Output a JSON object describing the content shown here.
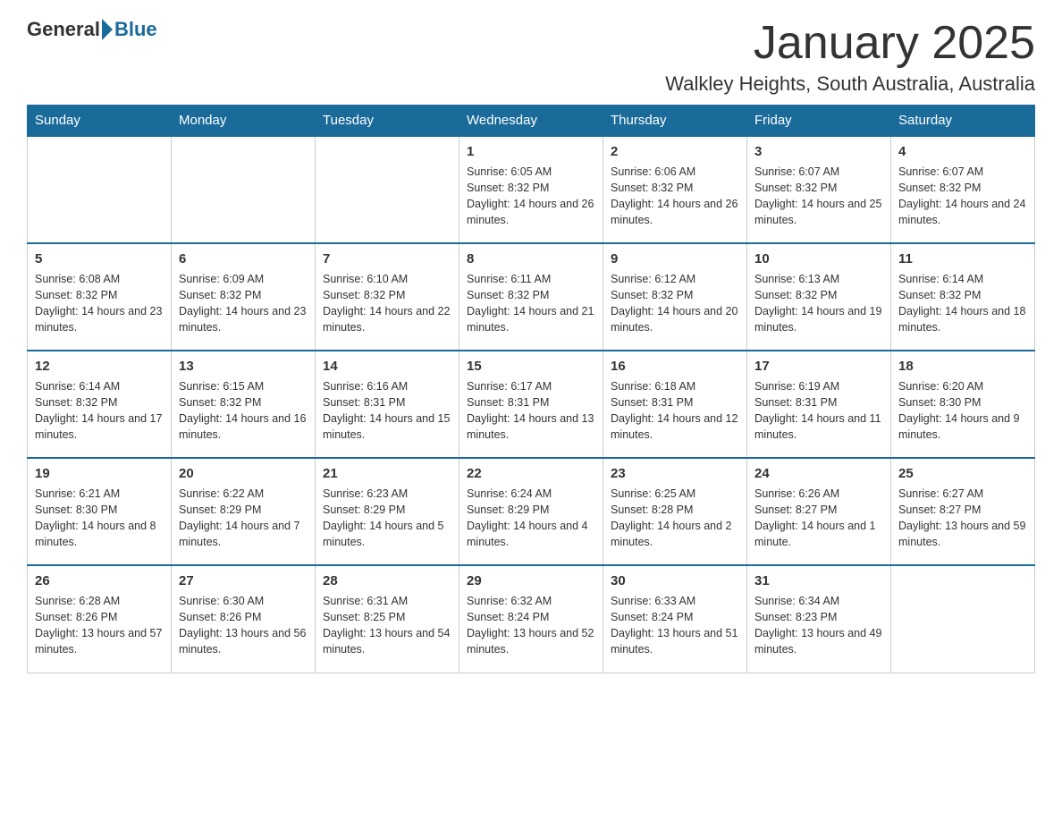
{
  "logo": {
    "general": "General",
    "blue": "Blue"
  },
  "title": "January 2025",
  "location": "Walkley Heights, South Australia, Australia",
  "weekdays": [
    "Sunday",
    "Monday",
    "Tuesday",
    "Wednesday",
    "Thursday",
    "Friday",
    "Saturday"
  ],
  "weeks": [
    [
      {
        "day": "",
        "info": ""
      },
      {
        "day": "",
        "info": ""
      },
      {
        "day": "",
        "info": ""
      },
      {
        "day": "1",
        "info": "Sunrise: 6:05 AM\nSunset: 8:32 PM\nDaylight: 14 hours and 26 minutes."
      },
      {
        "day": "2",
        "info": "Sunrise: 6:06 AM\nSunset: 8:32 PM\nDaylight: 14 hours and 26 minutes."
      },
      {
        "day": "3",
        "info": "Sunrise: 6:07 AM\nSunset: 8:32 PM\nDaylight: 14 hours and 25 minutes."
      },
      {
        "day": "4",
        "info": "Sunrise: 6:07 AM\nSunset: 8:32 PM\nDaylight: 14 hours and 24 minutes."
      }
    ],
    [
      {
        "day": "5",
        "info": "Sunrise: 6:08 AM\nSunset: 8:32 PM\nDaylight: 14 hours and 23 minutes."
      },
      {
        "day": "6",
        "info": "Sunrise: 6:09 AM\nSunset: 8:32 PM\nDaylight: 14 hours and 23 minutes."
      },
      {
        "day": "7",
        "info": "Sunrise: 6:10 AM\nSunset: 8:32 PM\nDaylight: 14 hours and 22 minutes."
      },
      {
        "day": "8",
        "info": "Sunrise: 6:11 AM\nSunset: 8:32 PM\nDaylight: 14 hours and 21 minutes."
      },
      {
        "day": "9",
        "info": "Sunrise: 6:12 AM\nSunset: 8:32 PM\nDaylight: 14 hours and 20 minutes."
      },
      {
        "day": "10",
        "info": "Sunrise: 6:13 AM\nSunset: 8:32 PM\nDaylight: 14 hours and 19 minutes."
      },
      {
        "day": "11",
        "info": "Sunrise: 6:14 AM\nSunset: 8:32 PM\nDaylight: 14 hours and 18 minutes."
      }
    ],
    [
      {
        "day": "12",
        "info": "Sunrise: 6:14 AM\nSunset: 8:32 PM\nDaylight: 14 hours and 17 minutes."
      },
      {
        "day": "13",
        "info": "Sunrise: 6:15 AM\nSunset: 8:32 PM\nDaylight: 14 hours and 16 minutes."
      },
      {
        "day": "14",
        "info": "Sunrise: 6:16 AM\nSunset: 8:31 PM\nDaylight: 14 hours and 15 minutes."
      },
      {
        "day": "15",
        "info": "Sunrise: 6:17 AM\nSunset: 8:31 PM\nDaylight: 14 hours and 13 minutes."
      },
      {
        "day": "16",
        "info": "Sunrise: 6:18 AM\nSunset: 8:31 PM\nDaylight: 14 hours and 12 minutes."
      },
      {
        "day": "17",
        "info": "Sunrise: 6:19 AM\nSunset: 8:31 PM\nDaylight: 14 hours and 11 minutes."
      },
      {
        "day": "18",
        "info": "Sunrise: 6:20 AM\nSunset: 8:30 PM\nDaylight: 14 hours and 9 minutes."
      }
    ],
    [
      {
        "day": "19",
        "info": "Sunrise: 6:21 AM\nSunset: 8:30 PM\nDaylight: 14 hours and 8 minutes."
      },
      {
        "day": "20",
        "info": "Sunrise: 6:22 AM\nSunset: 8:29 PM\nDaylight: 14 hours and 7 minutes."
      },
      {
        "day": "21",
        "info": "Sunrise: 6:23 AM\nSunset: 8:29 PM\nDaylight: 14 hours and 5 minutes."
      },
      {
        "day": "22",
        "info": "Sunrise: 6:24 AM\nSunset: 8:29 PM\nDaylight: 14 hours and 4 minutes."
      },
      {
        "day": "23",
        "info": "Sunrise: 6:25 AM\nSunset: 8:28 PM\nDaylight: 14 hours and 2 minutes."
      },
      {
        "day": "24",
        "info": "Sunrise: 6:26 AM\nSunset: 8:27 PM\nDaylight: 14 hours and 1 minute."
      },
      {
        "day": "25",
        "info": "Sunrise: 6:27 AM\nSunset: 8:27 PM\nDaylight: 13 hours and 59 minutes."
      }
    ],
    [
      {
        "day": "26",
        "info": "Sunrise: 6:28 AM\nSunset: 8:26 PM\nDaylight: 13 hours and 57 minutes."
      },
      {
        "day": "27",
        "info": "Sunrise: 6:30 AM\nSunset: 8:26 PM\nDaylight: 13 hours and 56 minutes."
      },
      {
        "day": "28",
        "info": "Sunrise: 6:31 AM\nSunset: 8:25 PM\nDaylight: 13 hours and 54 minutes."
      },
      {
        "day": "29",
        "info": "Sunrise: 6:32 AM\nSunset: 8:24 PM\nDaylight: 13 hours and 52 minutes."
      },
      {
        "day": "30",
        "info": "Sunrise: 6:33 AM\nSunset: 8:24 PM\nDaylight: 13 hours and 51 minutes."
      },
      {
        "day": "31",
        "info": "Sunrise: 6:34 AM\nSunset: 8:23 PM\nDaylight: 13 hours and 49 minutes."
      },
      {
        "day": "",
        "info": ""
      }
    ]
  ]
}
